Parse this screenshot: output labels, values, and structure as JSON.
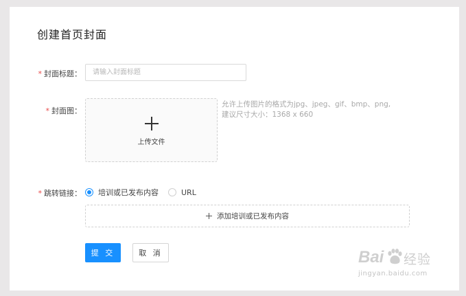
{
  "page": {
    "title": "创建首页封面"
  },
  "form": {
    "cover_title": {
      "required_mark": "*",
      "label": "封面标题：",
      "placeholder": "请输入封面标题",
      "value": ""
    },
    "cover_image": {
      "required_mark": "*",
      "label": "封面图：",
      "upload_label": "上传文件",
      "hint_line1": "允许上传图片的格式为jpg、jpeg、gif、bmp、png,",
      "hint_line2": "建议尺寸大小：1368 x 660"
    },
    "jump_link": {
      "required_mark": "*",
      "label": "跳转链接：",
      "options": [
        {
          "label": "培训或已发布内容",
          "checked": true
        },
        {
          "label": "URL",
          "checked": false
        }
      ],
      "add_content_label": "添加培训或已发布内容"
    },
    "actions": {
      "submit_label": "提 交",
      "cancel_label": "取 消"
    }
  },
  "watermark": {
    "brand": "Bai",
    "brand_suffix": "经验",
    "url": "jingyan.baidu.com"
  },
  "colors": {
    "primary": "#1890ff",
    "required": "#e84a4a",
    "background": "#e9e7e8",
    "panel": "#ffffff"
  },
  "icons": {
    "upload": "plus-icon",
    "add_content": "plus-icon",
    "watermark_logo": "paw-icon"
  }
}
